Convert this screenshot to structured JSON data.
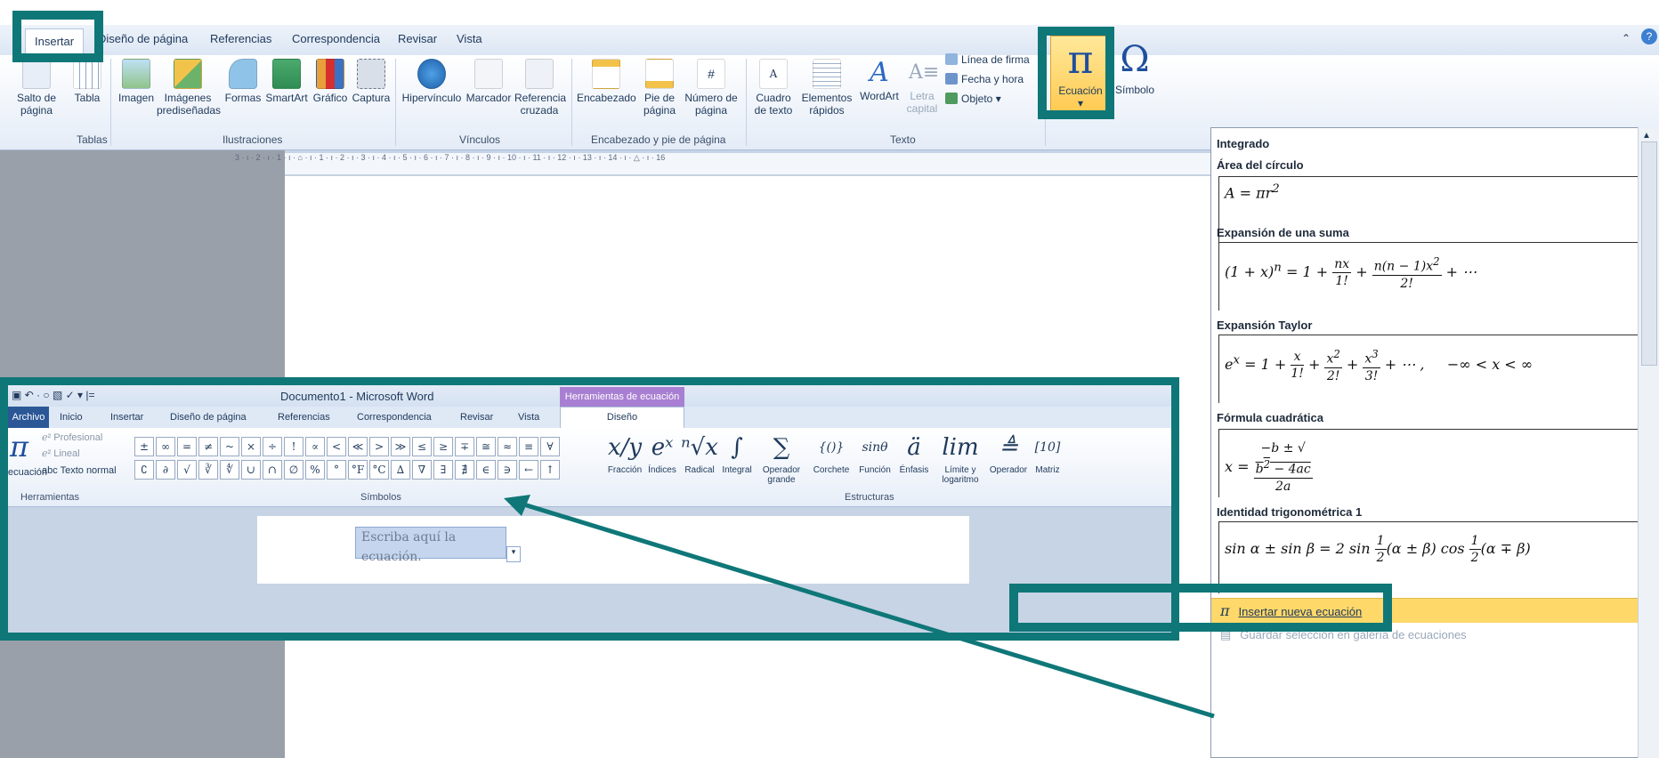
{
  "ribbon": {
    "tabs": [
      "Insertar",
      "Diseño de página",
      "Referencias",
      "Correspondencia",
      "Revisar",
      "Vista"
    ],
    "buttons": {
      "salto": "Salto de\npágina",
      "tabla": "Tabla",
      "imagen": "Imagen",
      "imagenes": "Imágenes\nprediseñadas",
      "formas": "Formas",
      "smartart": "SmartArt",
      "grafico": "Gráfico",
      "captura": "Captura",
      "hipervinculo": "Hipervínculo",
      "marcador": "Marcador",
      "referencia": "Referencia\ncruzada",
      "encabezado": "Encabezado",
      "pie": "Pie de\npágina",
      "numero": "Número de\npágina",
      "cuadro": "Cuadro\nde texto",
      "elementos": "Elementos\nrápidos",
      "wordart": "WordArt",
      "letra": "Letra\ncapital",
      "ecuacion": "Ecuación",
      "simbolo": "Símbolo"
    },
    "small": {
      "linea": "Línea de firma",
      "fecha": "Fecha y hora",
      "objeto": "Objeto"
    },
    "groups": {
      "tablas": "Tablas",
      "ilustraciones": "Ilustraciones",
      "vinculos": "Vínculos",
      "encabezado": "Encabezado y pie de página",
      "texto": "Texto"
    },
    "ruler": "3 · ı · 2 · ı · 1 · ı · ⌂ · ı · 1 · ı · 2 · ı · 3 · ı · 4 · ı · 5 · ı · 6 · ı · 7 · ı · 8 · ı · 9 · ı · 10 · ı · 11 · ı · 12 · ı · 13 · ı · 14 · ı · △ · ı · 16"
  },
  "inset": {
    "title": "Documento1 - Microsoft Word",
    "context_tab": "Herramientas de ecuación",
    "tabs": [
      "Archivo",
      "Inicio",
      "Insertar",
      "Diseño de página",
      "Referencias",
      "Correspondencia",
      "Revisar",
      "Vista",
      "Diseño"
    ],
    "herramientas": {
      "pi": "π",
      "ecuacion_label": "ecuación",
      "profesional": "Profesional",
      "lineal": "Lineal",
      "texto_normal": "Texto normal",
      "group": "Herramientas"
    },
    "symbols_row1": [
      "±",
      "∞",
      "=",
      "≠",
      "~",
      "×",
      "÷",
      "!",
      "∝",
      "<",
      "≪",
      ">",
      "≫",
      "≤",
      "≥",
      "∓",
      "≅",
      "≈",
      "≡",
      "∀"
    ],
    "symbols_row2": [
      "∁",
      "∂",
      "√",
      "∛",
      "∜",
      "∪",
      "∩",
      "∅",
      "%",
      "°",
      "°F",
      "°C",
      "∆",
      "∇",
      "∃",
      "∄",
      "∈",
      "∋",
      "←",
      "↑"
    ],
    "simbolos_group": "Símbolos",
    "estructuras": [
      {
        "glyph": "x/y",
        "label": "Fracción"
      },
      {
        "glyph": "eˣ",
        "label": "Índices"
      },
      {
        "glyph": "ⁿ√x",
        "label": "Radical"
      },
      {
        "glyph": "∫",
        "label": "Integral"
      },
      {
        "glyph": "∑",
        "label": "Operador\ngrande"
      },
      {
        "glyph": "{()}",
        "label": "Corchete"
      },
      {
        "glyph": "sinθ",
        "label": "Función"
      },
      {
        "glyph": "ä",
        "label": "Énfasis"
      },
      {
        "glyph": "lim",
        "label": "Límite y\nlogaritmo"
      },
      {
        "glyph": "≜",
        "label": "Operador"
      },
      {
        "glyph": "[10]",
        "label": "Matriz"
      }
    ],
    "estructuras_group": "Estructuras",
    "placeholder": "Escriba aquí la ecuación."
  },
  "panel": {
    "header": "Integrado",
    "items": [
      {
        "title": "Área del círculo"
      },
      {
        "title": "Expansión de una suma"
      },
      {
        "title": "Expansión Taylor"
      },
      {
        "title": "Fórmula cuadrática"
      },
      {
        "title": "Identidad trigonométrica 1"
      }
    ],
    "insert_new": "Insertar nueva ecuación",
    "save_selection": "Guardar selección en galería de ecuaciones"
  },
  "colors": {
    "highlight": "#0f7778",
    "ribbon_text": "#1e395b",
    "context_tab": "#a87fd2",
    "selected": "#ffd86a"
  }
}
